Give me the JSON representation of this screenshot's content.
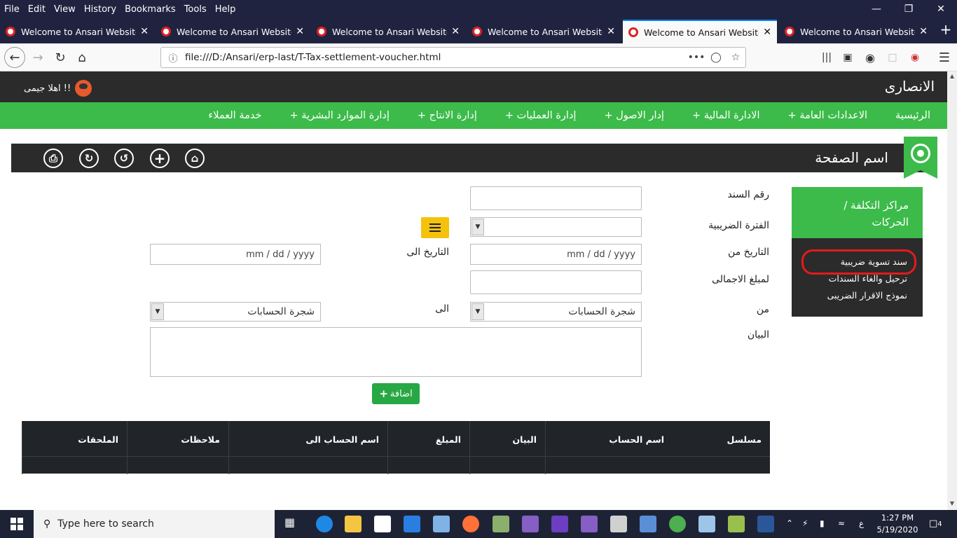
{
  "browser": {
    "menu": [
      "File",
      "Edit",
      "View",
      "History",
      "Bookmarks",
      "Tools",
      "Help"
    ],
    "tabs": [
      {
        "title": "Welcome to Ansari Website"
      },
      {
        "title": "Welcome to Ansari Website"
      },
      {
        "title": "Welcome to Ansari Website"
      },
      {
        "title": "Welcome to Ansari Website"
      },
      {
        "title": "Welcome to Ansari Website",
        "active": true
      },
      {
        "title": "Welcome to Ansari Website"
      }
    ],
    "url": "file:///D:/Ansari/erp-last/T-Tax-settlement-voucher.html",
    "url_more": "•••"
  },
  "site": {
    "brand": "الانصارى",
    "greeting": "اهلا جيمى !!",
    "nav": [
      "الرئيسية",
      "الاعدادات العامة +",
      "الادارة المالية +",
      "إدار الاصول +",
      "إدارة العمليات +",
      "إدارة الانتاج +",
      "إدارة الموارد البشرية +",
      "خدمة العملاء"
    ],
    "page_title": "اسم الصفحة"
  },
  "side": {
    "heading": "مراكز التكلفة / الحركات",
    "links": [
      "سند تسوية ضريبية",
      "ترحيل والغاء السندات",
      "نموذج الاقرار الضريبى"
    ]
  },
  "form": {
    "voucher_no_label": "رقم السند",
    "tax_period_label": "الفترة الضريبية",
    "date_from_label": "التاريخ من",
    "date_to_label": "التاريخ الى",
    "date_placeholder": "mm / dd / yyyy",
    "total_amount_label": "لمبلغ الاجمالى",
    "from_label": "من",
    "to_label": "الى",
    "account_tree": "شجرة الحسابات",
    "description_label": "البيان",
    "add_button": "اضافة"
  },
  "table": {
    "headers": [
      "مسلسل",
      "اسم الحساب",
      "البيان",
      "المبلغ",
      "اسم الحساب الى",
      "ملاحظات",
      "الملحقات"
    ]
  },
  "taskbar": {
    "search_placeholder": "Type here to search",
    "time": "1:27 PM",
    "date": "5/19/2020",
    "notifications": "4",
    "lang": "ع"
  },
  "colors": {
    "green": "#3cbb4a",
    "dark": "#2b2b2b",
    "yellow": "#f4c20d",
    "add": "#28a745",
    "highlight": "#e31b1b"
  }
}
